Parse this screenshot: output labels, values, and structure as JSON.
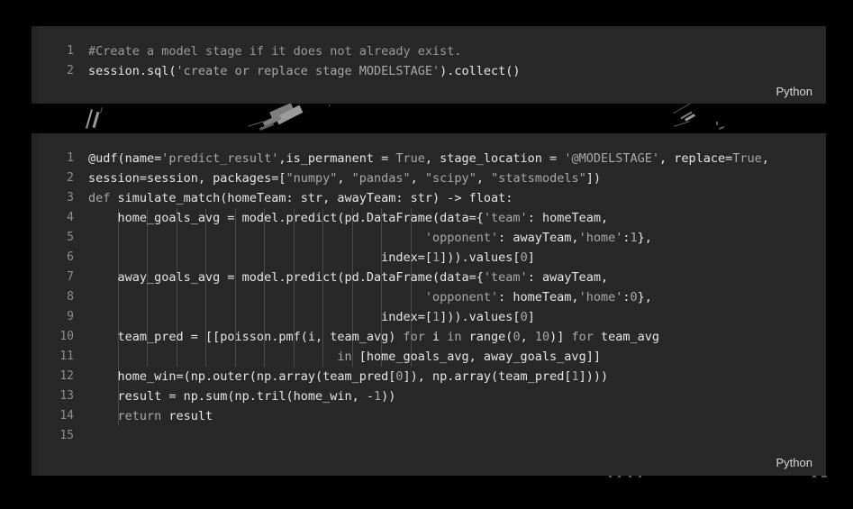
{
  "window": {
    "background_color": "#000000",
    "code_block_color": "#282828",
    "gutter_color": "#232323",
    "text_color": "#e6e6e6",
    "dim_text_color": "#9a9a9a",
    "line_number_color": "#8e8e8e"
  },
  "blocks": [
    {
      "id": "code-block-1",
      "language_label": "Python",
      "lines": [
        {
          "number": "1",
          "tokens": [
            {
              "t": "#Create a model stage if it does not already exist.",
              "c": "c-comment"
            }
          ]
        },
        {
          "number": "2",
          "tokens": [
            {
              "t": "session.sql(",
              "c": "c-plain"
            },
            {
              "t": "'create or replace stage MODELSTAGE'",
              "c": "c-str"
            },
            {
              "t": ").collect()",
              "c": "c-plain"
            }
          ]
        }
      ]
    },
    {
      "id": "code-block-2",
      "language_label": "Python",
      "lines": [
        {
          "number": "1",
          "tokens": [
            {
              "t": "@udf(name=",
              "c": "c-plain"
            },
            {
              "t": "'predict_result'",
              "c": "c-str"
            },
            {
              "t": ",is_permanent = ",
              "c": "c-plain"
            },
            {
              "t": "True",
              "c": "c-kw"
            },
            {
              "t": ", stage_location = ",
              "c": "c-plain"
            },
            {
              "t": "'@MODELSTAGE'",
              "c": "c-str"
            },
            {
              "t": ", replace=",
              "c": "c-plain"
            },
            {
              "t": "True",
              "c": "c-kw"
            },
            {
              "t": ",",
              "c": "c-plain"
            }
          ]
        },
        {
          "number": "2",
          "tokens": [
            {
              "t": "session=session, packages=[",
              "c": "c-plain"
            },
            {
              "t": "\"numpy\"",
              "c": "c-str"
            },
            {
              "t": ", ",
              "c": "c-plain"
            },
            {
              "t": "\"pandas\"",
              "c": "c-str"
            },
            {
              "t": ", ",
              "c": "c-plain"
            },
            {
              "t": "\"scipy\"",
              "c": "c-str"
            },
            {
              "t": ", ",
              "c": "c-plain"
            },
            {
              "t": "\"statsmodels\"",
              "c": "c-str"
            },
            {
              "t": "])",
              "c": "c-plain"
            }
          ]
        },
        {
          "number": "3",
          "tokens": [
            {
              "t": "def ",
              "c": "c-kw"
            },
            {
              "t": "simulate_match(homeTeam: str, awayTeam: str) -> float:",
              "c": "c-plain"
            }
          ]
        },
        {
          "number": "4",
          "tokens": [
            {
              "t": "    home_goals_avg = model.predict(pd.DataFrame(data={",
              "c": "c-plain"
            },
            {
              "t": "'team'",
              "c": "c-str"
            },
            {
              "t": ": homeTeam,",
              "c": "c-plain"
            }
          ]
        },
        {
          "number": "5",
          "tokens": [
            {
              "t": "                                              ",
              "c": "c-plain"
            },
            {
              "t": "'opponent'",
              "c": "c-str"
            },
            {
              "t": ": awayTeam,",
              "c": "c-plain"
            },
            {
              "t": "'home'",
              "c": "c-str"
            },
            {
              "t": ":",
              "c": "c-plain"
            },
            {
              "t": "1",
              "c": "c-num"
            },
            {
              "t": "},",
              "c": "c-plain"
            }
          ]
        },
        {
          "number": "6",
          "tokens": [
            {
              "t": "                                        index=[",
              "c": "c-plain"
            },
            {
              "t": "1",
              "c": "c-num"
            },
            {
              "t": "])).values[",
              "c": "c-plain"
            },
            {
              "t": "0",
              "c": "c-num"
            },
            {
              "t": "]",
              "c": "c-plain"
            }
          ]
        },
        {
          "number": "7",
          "tokens": [
            {
              "t": "    away_goals_avg = model.predict(pd.DataFrame(data={",
              "c": "c-plain"
            },
            {
              "t": "'team'",
              "c": "c-str"
            },
            {
              "t": ": awayTeam,",
              "c": "c-plain"
            }
          ]
        },
        {
          "number": "8",
          "tokens": [
            {
              "t": "                                              ",
              "c": "c-plain"
            },
            {
              "t": "'opponent'",
              "c": "c-str"
            },
            {
              "t": ": homeTeam,",
              "c": "c-plain"
            },
            {
              "t": "'home'",
              "c": "c-str"
            },
            {
              "t": ":",
              "c": "c-plain"
            },
            {
              "t": "0",
              "c": "c-num"
            },
            {
              "t": "},",
              "c": "c-plain"
            }
          ]
        },
        {
          "number": "9",
          "tokens": [
            {
              "t": "                                        index=[",
              "c": "c-plain"
            },
            {
              "t": "1",
              "c": "c-num"
            },
            {
              "t": "])).values[",
              "c": "c-plain"
            },
            {
              "t": "0",
              "c": "c-num"
            },
            {
              "t": "]",
              "c": "c-plain"
            }
          ]
        },
        {
          "number": "10",
          "tokens": [
            {
              "t": "    team_pred = [[poisson.pmf(i, team_avg) ",
              "c": "c-plain"
            },
            {
              "t": "for ",
              "c": "c-kw"
            },
            {
              "t": "i ",
              "c": "c-plain"
            },
            {
              "t": "in ",
              "c": "c-kw"
            },
            {
              "t": "range(",
              "c": "c-plain"
            },
            {
              "t": "0",
              "c": "c-num"
            },
            {
              "t": ", ",
              "c": "c-plain"
            },
            {
              "t": "10",
              "c": "c-num"
            },
            {
              "t": ")] ",
              "c": "c-plain"
            },
            {
              "t": "for ",
              "c": "c-kw"
            },
            {
              "t": "team_avg",
              "c": "c-plain"
            }
          ]
        },
        {
          "number": "11",
          "tokens": [
            {
              "t": "                                  ",
              "c": "c-plain"
            },
            {
              "t": "in ",
              "c": "c-kw"
            },
            {
              "t": "[home_goals_avg, away_goals_avg]]",
              "c": "c-plain"
            }
          ]
        },
        {
          "number": "12",
          "tokens": [
            {
              "t": "    home_win=(np.outer(np.array(team_pred[",
              "c": "c-plain"
            },
            {
              "t": "0",
              "c": "c-num"
            },
            {
              "t": "]), np.array(team_pred[",
              "c": "c-plain"
            },
            {
              "t": "1",
              "c": "c-num"
            },
            {
              "t": "])))",
              "c": "c-plain"
            }
          ]
        },
        {
          "number": "13",
          "tokens": [
            {
              "t": "    result = np.sum(np.tril(home_win, -",
              "c": "c-plain"
            },
            {
              "t": "1",
              "c": "c-num"
            },
            {
              "t": "))",
              "c": "c-plain"
            }
          ]
        },
        {
          "number": "14",
          "tokens": [
            {
              "t": "    ",
              "c": "c-plain"
            },
            {
              "t": "return ",
              "c": "c-kw"
            },
            {
              "t": "result",
              "c": "c-plain"
            }
          ]
        },
        {
          "number": "15",
          "tokens": [
            {
              "t": "",
              "c": "c-plain"
            }
          ]
        }
      ]
    }
  ],
  "indent_guides": {
    "columns": [
      0,
      4,
      8,
      12,
      16,
      20,
      24,
      28,
      32,
      36,
      40,
      44
    ],
    "color": "#4a4a4a"
  },
  "artifacts": {
    "description": "grey scratch marks / partial glyph remnants in the black gap between code blocks",
    "color": "#9b9b9b"
  }
}
